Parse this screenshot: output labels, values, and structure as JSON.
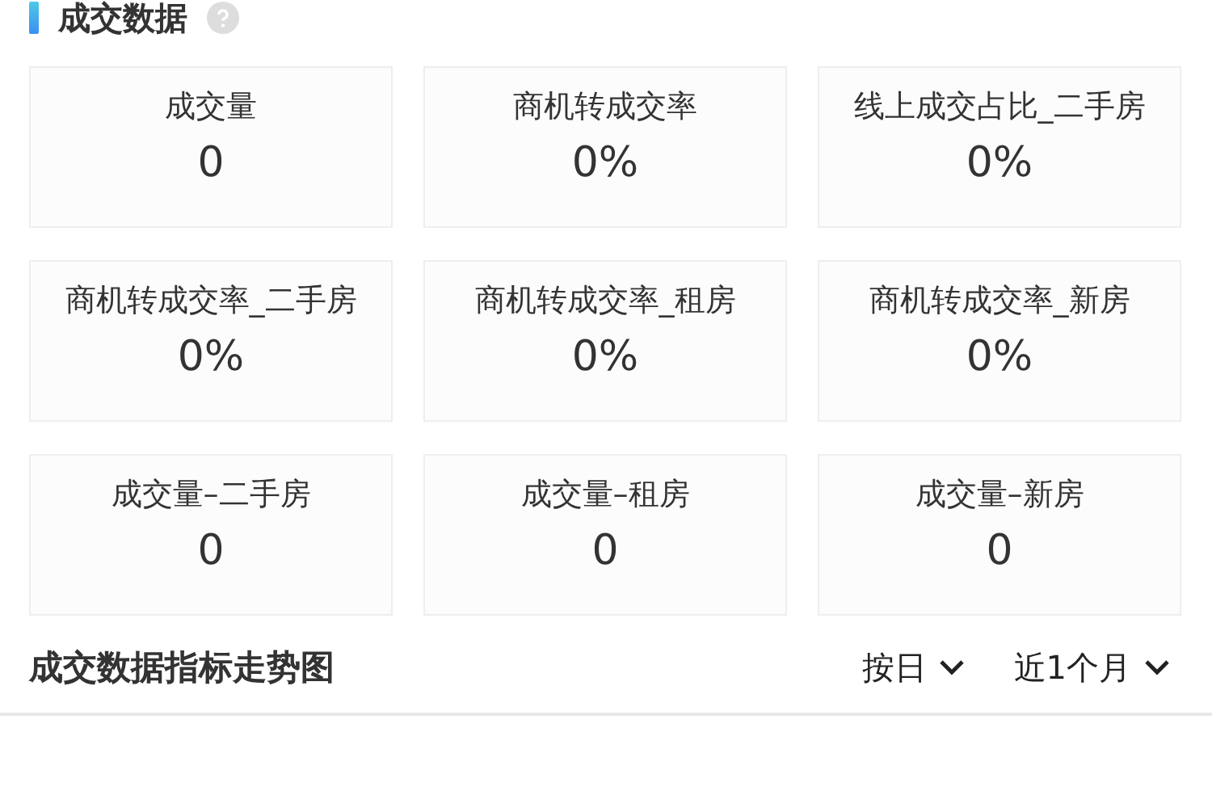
{
  "section": {
    "title": "成交数据"
  },
  "metrics": [
    {
      "label": "成交量",
      "value": "0"
    },
    {
      "label": "商机转成交率",
      "value": "0%"
    },
    {
      "label": "线上成交占比_二手房",
      "value": "0%"
    },
    {
      "label": "商机转成交率_二手房",
      "value": "0%"
    },
    {
      "label": "商机转成交率_租房",
      "value": "0%"
    },
    {
      "label": "商机转成交率_新房",
      "value": "0%"
    },
    {
      "label": "成交量–二手房",
      "value": "0"
    },
    {
      "label": "成交量–租房",
      "value": "0"
    },
    {
      "label": "成交量–新房",
      "value": "0"
    }
  ],
  "trend": {
    "title": "成交数据指标走势图",
    "filters": [
      {
        "label": "按日"
      },
      {
        "label": "近1个月"
      }
    ]
  }
}
